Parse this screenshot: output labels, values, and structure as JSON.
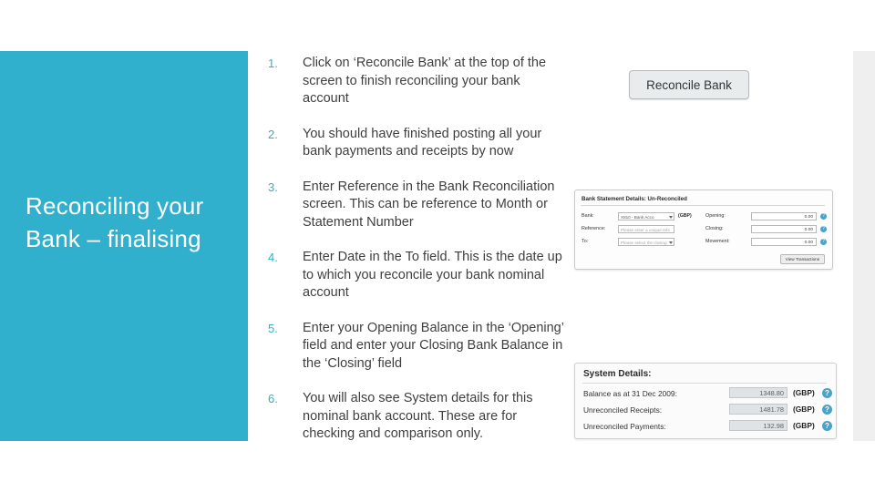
{
  "slide": {
    "title": "Reconciling your Bank – finalising",
    "steps": [
      {
        "num": "1.",
        "text": "Click on ‘Reconcile Bank’ at the top of the screen to finish reconciling your bank account"
      },
      {
        "num": "2.",
        "text": "You should have finished posting all your bank payments and receipts by now"
      },
      {
        "num": "3.",
        "text": "Enter Reference in the Bank Reconciliation screen. This can be reference to Month or Statement Number"
      },
      {
        "num": "4.",
        "text": "Enter Date in the To field. This is the date up to which you reconcile your bank nominal account"
      },
      {
        "num": "5.",
        "text": "Enter your Opening Balance in the ‘Opening’ field and enter your Closing Bank Balance in the ‘Closing’ field"
      },
      {
        "num": "6.",
        "text": "You will also see System details for this nominal bank account. These are for checking and comparison only."
      }
    ]
  },
  "figures": {
    "reconcile_button": {
      "label": "Reconcile Bank"
    },
    "bank_statement_details": {
      "title": "Bank Statement Details: Un-Reconciled",
      "rows": [
        {
          "label": "Bank:",
          "value": "X810 - Bank Acco",
          "currency": "(GBP)",
          "label2": "Opening:",
          "value2": "0.00"
        },
        {
          "label": "Reference:",
          "value": "Please enter a unique refe",
          "currency": "",
          "label2": "Closing:",
          "value2": "0.00"
        },
        {
          "label": "To:",
          "value": "Please select the closing",
          "currency": "",
          "label2": "Movement:",
          "value2": "0.00"
        }
      ],
      "button": "View Transactions"
    },
    "system_details": {
      "title": "System Details:",
      "rows": [
        {
          "label": "Balance as at 31 Dec 2009:",
          "value": "1348.80",
          "currency": "(GBP)",
          "help": "?"
        },
        {
          "label": "Unreconciled Receipts:",
          "value": "1481.78",
          "currency": "(GBP)",
          "help": "?"
        },
        {
          "label": "Unreconciled Payments:",
          "value": "132.98",
          "currency": "(GBP)",
          "help": "?"
        }
      ]
    }
  },
  "colors": {
    "accent": "#31b0cd",
    "body_text": "#3f3f3f"
  }
}
